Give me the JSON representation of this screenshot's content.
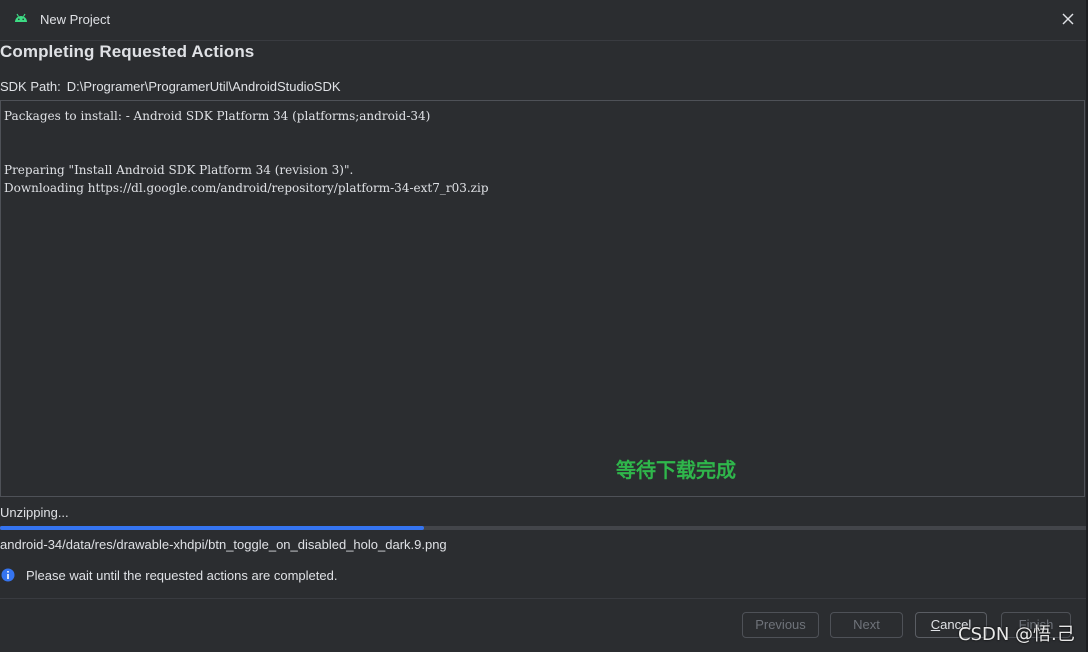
{
  "window": {
    "title": "New Project"
  },
  "page": {
    "heading": "Completing Requested Actions",
    "sdk_path_label": "SDK Path:",
    "sdk_path_value": "D:\\Programer\\ProgramerUtil\\AndroidStudioSDK"
  },
  "log": {
    "lines": [
      "Packages to install: - Android SDK Platform 34 (platforms;android-34)",
      "",
      "",
      "Preparing \"Install Android SDK Platform 34 (revision 3)\".",
      "Downloading https://dl.google.com/android/repository/platform-34-ext7_r03.zip"
    ]
  },
  "annotation": {
    "note": "等待下载完成",
    "color": "#2fb64b"
  },
  "progress": {
    "status": "Unzipping...",
    "fraction": 0.39,
    "current_file": "android-34/data/res/drawable-xhdpi/btn_toggle_on_disabled_holo_dark.9.png",
    "bar_color": "#3574f0"
  },
  "info": {
    "icon": "info-icon",
    "message": "Please wait until the requested actions are completed."
  },
  "buttons": {
    "previous": "Previous",
    "next": "Next",
    "cancel": "Cancel",
    "finish": "Finish"
  },
  "watermark": {
    "text": "CSDN @悟.己"
  }
}
